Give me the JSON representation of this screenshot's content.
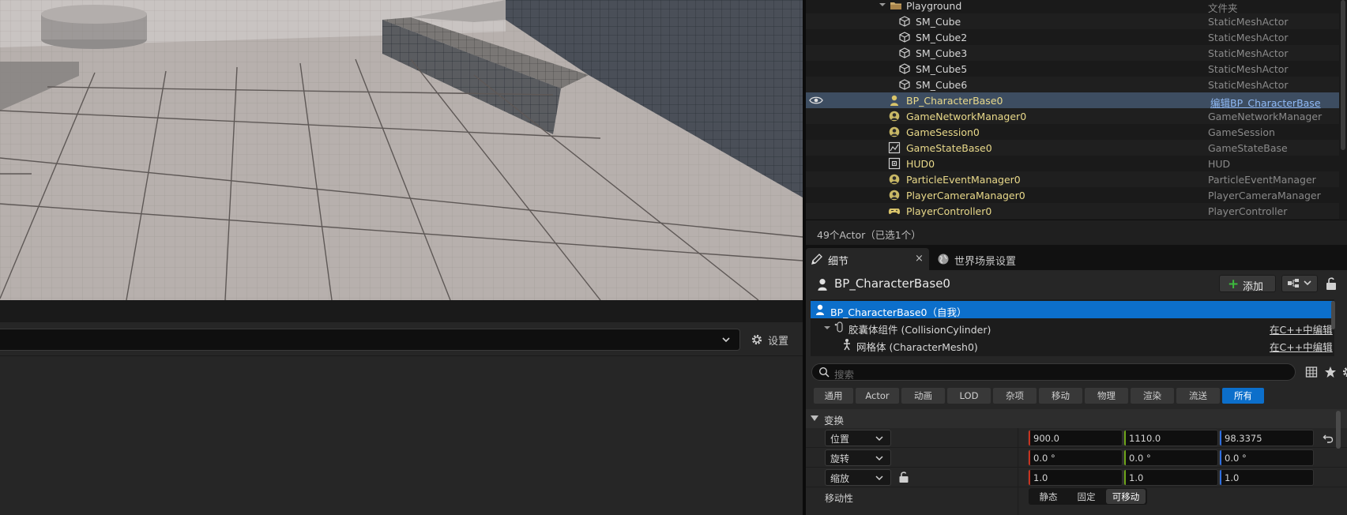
{
  "outliner": {
    "rows": [
      {
        "name": "Playground",
        "type": "文件夹",
        "icon": "folder-icon"
      },
      {
        "name": "SM_Cube",
        "type": "StaticMeshActor",
        "icon": "static-mesh-icon"
      },
      {
        "name": "SM_Cube2",
        "type": "StaticMeshActor",
        "icon": "static-mesh-icon"
      },
      {
        "name": "SM_Cube3",
        "type": "StaticMeshActor",
        "icon": "static-mesh-icon"
      },
      {
        "name": "SM_Cube5",
        "type": "StaticMeshActor",
        "icon": "static-mesh-icon"
      },
      {
        "name": "SM_Cube6",
        "type": "StaticMeshActor",
        "icon": "static-mesh-icon"
      },
      {
        "name": "BP_CharacterBase0",
        "type": "编辑BP_CharacterBase",
        "icon": "character-icon"
      },
      {
        "name": "GameNetworkManager0",
        "type": "GameNetworkManager",
        "icon": "actor-icon"
      },
      {
        "name": "GameSession0",
        "type": "GameSession",
        "icon": "actor-icon"
      },
      {
        "name": "GameStateBase0",
        "type": "GameStateBase",
        "icon": "game-state-icon"
      },
      {
        "name": "HUD0",
        "type": "HUD",
        "icon": "hud-icon"
      },
      {
        "name": "ParticleEventManager0",
        "type": "ParticleEventManager",
        "icon": "actor-icon"
      },
      {
        "name": "PlayerCameraManager0",
        "type": "PlayerCameraManager",
        "icon": "actor-icon"
      },
      {
        "name": "PlayerController0",
        "type": "PlayerController",
        "icon": "gamepad-icon"
      }
    ],
    "status": "49个Actor（已选1个）"
  },
  "lower_panel": {
    "settings_label": "设置"
  },
  "details": {
    "tab_details": "细节",
    "tab_close": "×",
    "tab_world": "世界场景设置",
    "actor_name": "BP_CharacterBase0",
    "add_label": "添加",
    "components": [
      {
        "name": "BP_CharacterBase0（自我）",
        "edit": ""
      },
      {
        "name": "胶囊体组件 (CollisionCylinder)",
        "edit": "在C++中编辑"
      },
      {
        "name": "网格体 (CharacterMesh0)",
        "edit": "在C++中编辑"
      }
    ],
    "search_placeholder": "搜索",
    "filters": [
      "通用",
      "Actor",
      "动画",
      "LOD",
      "杂项",
      "移动",
      "物理",
      "渲染",
      "流送",
      "所有"
    ],
    "active_filter": "所有",
    "section_transform": "变换",
    "transform": [
      {
        "label": "位置",
        "x": "900.0",
        "y": "1110.0",
        "z": "98.3375"
      },
      {
        "label": "旋转",
        "x": "0.0 °",
        "y": "0.0 °",
        "z": "0.0 °"
      },
      {
        "label": "缩放",
        "x": "1.0",
        "y": "1.0",
        "z": "1.0"
      }
    ],
    "mobility_label": "移动性",
    "mobility_options": [
      "静态",
      "固定",
      "可移动"
    ],
    "mobility_selected": "可移动"
  },
  "colors": {
    "selection_blue": "#0c6fcb",
    "outliner_selected": "#3d4d61",
    "axis_x": "#c8321e",
    "axis_y": "#6ea518",
    "axis_z": "#2f6fe0",
    "actor_label": "#e9d98a"
  }
}
